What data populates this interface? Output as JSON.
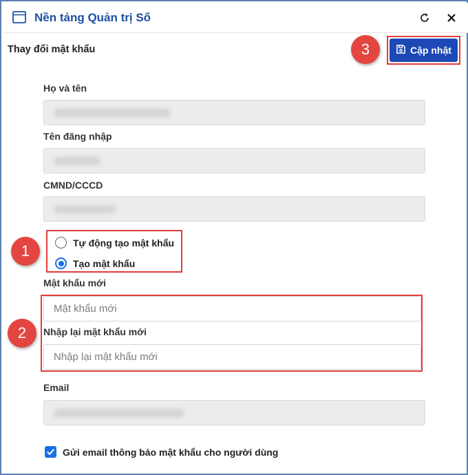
{
  "window": {
    "title": "Nền tảng Quản trị Số"
  },
  "form": {
    "title": "Thay đổi mật khẩu",
    "update_button": "Cập nhật",
    "fields": {
      "full_name_label": "Họ và tên",
      "username_label": "Tên đăng nhập",
      "id_label": "CMND/CCCD",
      "email_label": "Email"
    },
    "password_mode": {
      "auto_label": "Tự động tạo mật khẩu",
      "manual_label": "Tạo mật khẩu",
      "selected": "manual"
    },
    "new_password": {
      "label": "Mật khẩu mới",
      "placeholder": "Mật khẩu mới",
      "value": ""
    },
    "confirm_password": {
      "label": "Nhập lại mật khẩu mới",
      "placeholder": "Nhập lại mật khẩu mới",
      "value": ""
    },
    "send_email": {
      "label": "Gửi email thông báo mật khẩu cho người dùng",
      "checked": true
    }
  },
  "markers": {
    "m1": "1",
    "m2": "2",
    "m3": "3"
  },
  "colors": {
    "accent": "#1d49b6",
    "highlight": "#e03c3c",
    "marker": "#e34640",
    "title": "#1f4fa3"
  },
  "icons": {
    "window": "window-icon",
    "reload": "reload-icon",
    "close": "close-icon",
    "save": "save-icon"
  }
}
